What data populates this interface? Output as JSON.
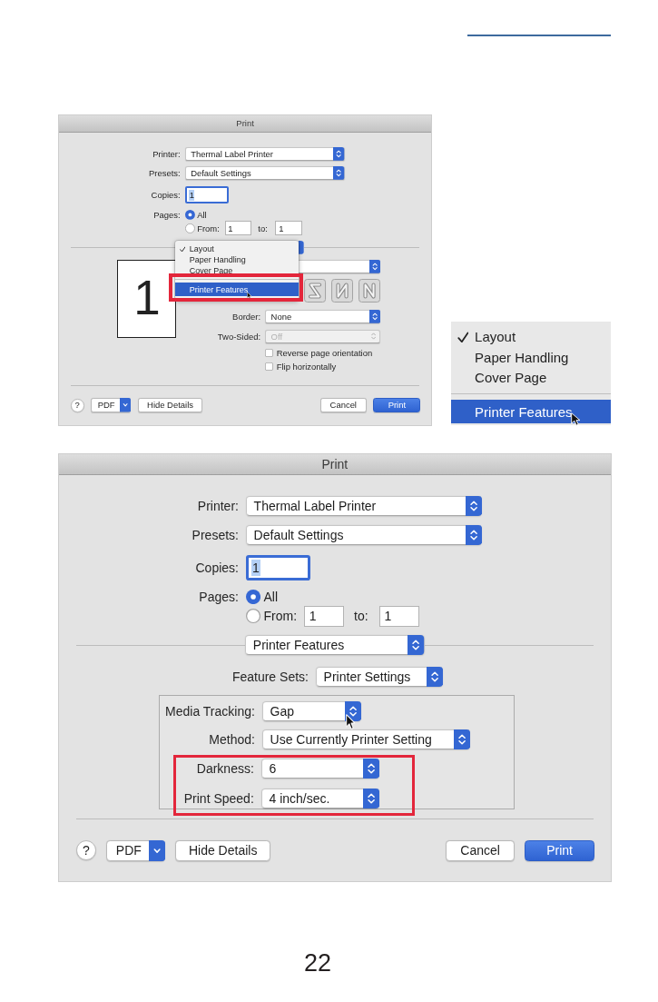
{
  "dialog_top": {
    "title": "Print",
    "printer": {
      "label": "Printer:",
      "value": "Thermal Label Printer"
    },
    "presets": {
      "label": "Presets:",
      "value": "Default Settings"
    },
    "copies": {
      "label": "Copies:",
      "value": "1",
      "focused": true,
      "text_selected": true
    },
    "pages": {
      "label": "Pages:",
      "options": [
        {
          "kind": "all",
          "label": "All",
          "selected": true
        },
        {
          "kind": "range",
          "label": "From:",
          "selected": false,
          "from": "1",
          "to_label": "to:",
          "to": "1"
        }
      ]
    },
    "section_menu": {
      "items": [
        {
          "kind": "item",
          "label": "Layout",
          "checked": true,
          "selected": false,
          "highlighted": false,
          "hovered": false
        },
        {
          "kind": "item",
          "label": "Paper Handling",
          "checked": false,
          "selected": false,
          "highlighted": false,
          "hovered": false
        },
        {
          "kind": "item",
          "label": "Cover Page",
          "checked": false,
          "selected": false,
          "highlighted": false,
          "hovered": false
        },
        {
          "kind": "separator"
        },
        {
          "kind": "item",
          "label": "Printer Features",
          "checked": false,
          "selected": true,
          "highlighted": true,
          "hovered": true
        }
      ]
    },
    "preview": {
      "page_number": "1"
    },
    "border": {
      "label": "Border:",
      "value": "None"
    },
    "two_sided": {
      "label": "Two-Sided:",
      "value": "Off",
      "disabled": true
    },
    "options": [
      {
        "label": "Reverse page orientation",
        "checked": false
      },
      {
        "label": "Flip horizontally",
        "checked": false
      }
    ],
    "left_buttons": [
      {
        "kind": "help",
        "label": "?"
      },
      {
        "kind": "menu",
        "label": "PDF"
      },
      {
        "kind": "plain",
        "label": "Hide Details"
      }
    ],
    "right_buttons": [
      {
        "kind": "plain",
        "label": "Cancel"
      },
      {
        "kind": "default",
        "label": "Print"
      }
    ]
  },
  "menu_closeup": {
    "items": [
      {
        "kind": "item",
        "label": "Layout",
        "checked": true,
        "selected": false,
        "hovered": false
      },
      {
        "kind": "item",
        "label": "Paper Handling",
        "checked": false,
        "selected": false,
        "hovered": false
      },
      {
        "kind": "item",
        "label": "Cover Page",
        "checked": false,
        "selected": false,
        "hovered": false
      },
      {
        "kind": "separator"
      },
      {
        "kind": "item",
        "label": "Printer Features",
        "checked": false,
        "selected": true,
        "hovered": true
      }
    ]
  },
  "dialog_bottom": {
    "title": "Print",
    "printer": {
      "label": "Printer:",
      "value": "Thermal Label Printer"
    },
    "presets": {
      "label": "Presets:",
      "value": "Default Settings"
    },
    "copies": {
      "label": "Copies:",
      "value": "1",
      "focused": true,
      "text_selected": true
    },
    "pages": {
      "label": "Pages:",
      "options": [
        {
          "kind": "all",
          "label": "All",
          "selected": true
        },
        {
          "kind": "range",
          "label": "From:",
          "selected": false,
          "from": "1",
          "to_label": "to:",
          "to": "1"
        }
      ]
    },
    "section": {
      "value": "Printer Features"
    },
    "feature_sets": {
      "label": "Feature Sets:",
      "value": "Printer Settings"
    },
    "settings": [
      {
        "label": "Media Tracking:",
        "value": "Gap",
        "highlighted": false,
        "hovered": true
      },
      {
        "label": "Method:",
        "value": "Use Currently Printer Setting",
        "highlighted": false,
        "hovered": false
      },
      {
        "label": "Darkness:",
        "value": "6",
        "highlighted": true,
        "hovered": false
      },
      {
        "label": "Print Speed:",
        "value": "4 inch/sec.",
        "highlighted": true,
        "hovered": false
      }
    ],
    "left_buttons": [
      {
        "kind": "help",
        "label": "?"
      },
      {
        "kind": "menu",
        "label": "PDF"
      },
      {
        "kind": "plain",
        "label": "Hide Details"
      }
    ],
    "right_buttons": [
      {
        "kind": "plain",
        "label": "Cancel"
      },
      {
        "kind": "default",
        "label": "Print"
      }
    ]
  },
  "page_number": "22"
}
